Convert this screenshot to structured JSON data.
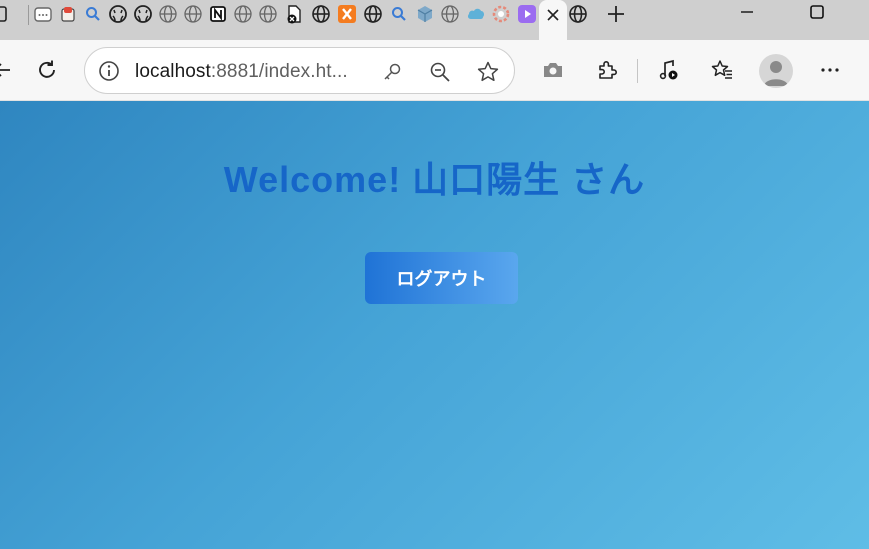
{
  "tabs": {
    "icons": [
      "documents-icon",
      "sushi-icon",
      "search-icon",
      "github-icon",
      "github-icon",
      "globe-icon",
      "globe-icon",
      "notion-icon",
      "globe-icon",
      "globe-icon",
      "document-closed-icon",
      "globe-icon",
      "xampp-icon",
      "globe-icon",
      "search-icon",
      "box-icon",
      "globe-icon",
      "cloud-icon",
      "flower-icon",
      "video-icon"
    ],
    "active_close": "×",
    "new_tab": "+"
  },
  "window": {
    "minimize": "—",
    "maximize": "☐"
  },
  "address": {
    "host": "localhost",
    "rest": ":8881/index.ht..."
  },
  "page": {
    "welcome": "Welcome! 山口陽生 さん",
    "logout_label": "ログアウト"
  },
  "colors": {
    "accent_blue": "#1666c8",
    "button_start": "#1f73d6",
    "button_end": "#5aa7ee",
    "bg_start": "#2f86c0",
    "bg_end": "#5fbde6"
  }
}
